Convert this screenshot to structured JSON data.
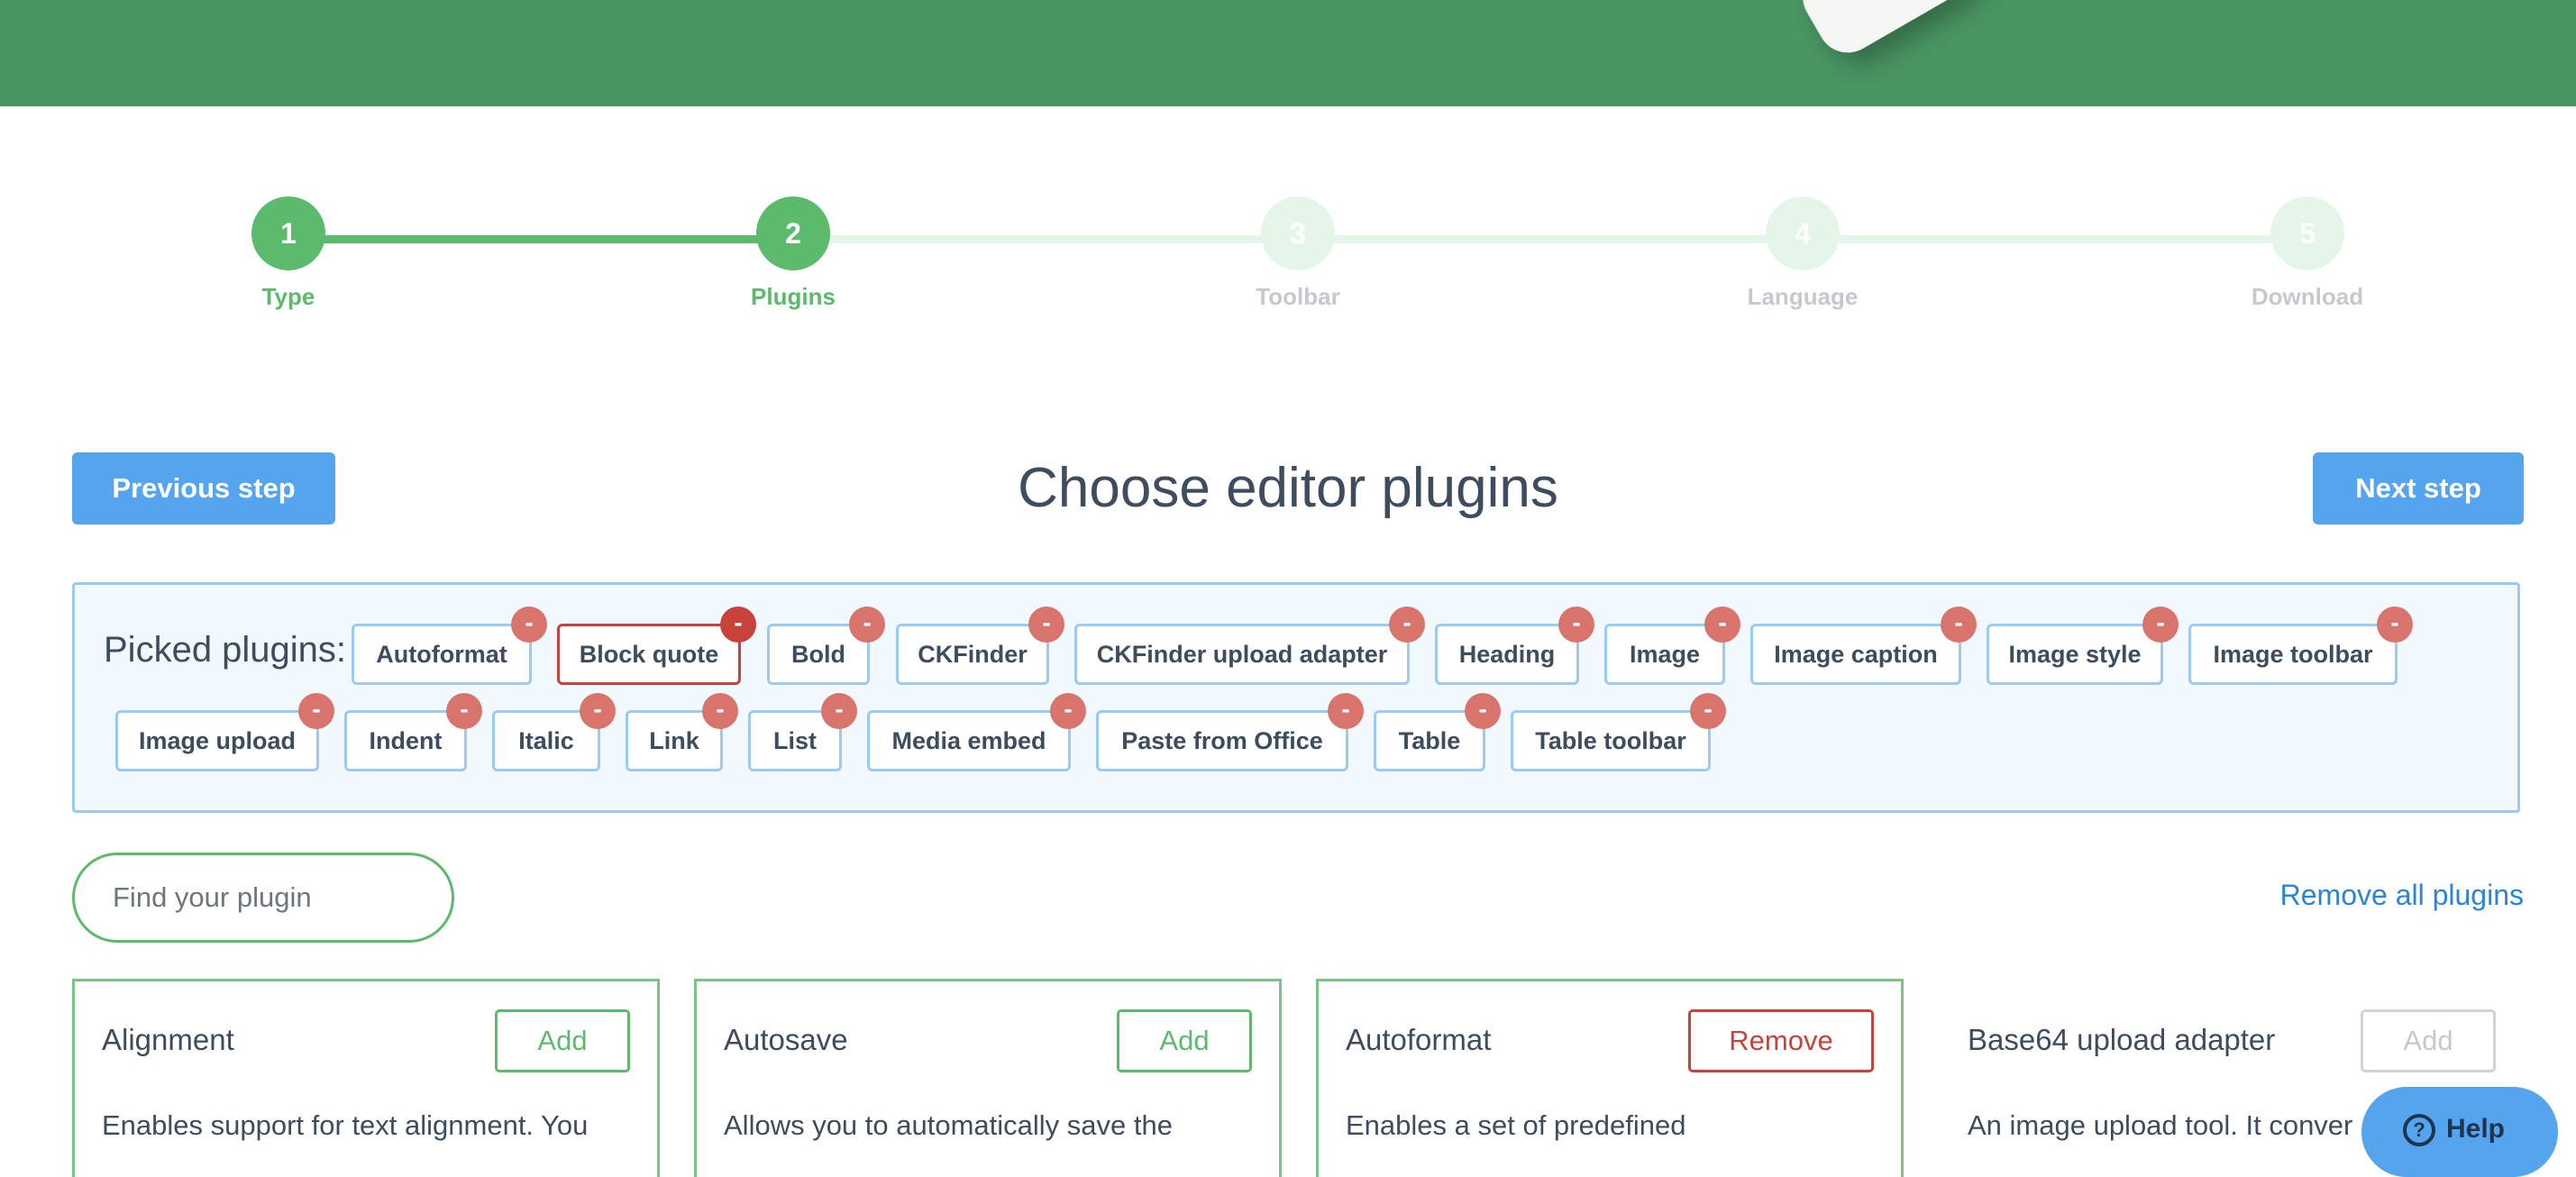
{
  "steps": [
    {
      "number": "1",
      "label": "Type",
      "state": "done"
    },
    {
      "number": "2",
      "label": "Plugins",
      "state": "done"
    },
    {
      "number": "3",
      "label": "Toolbar",
      "state": "todo"
    },
    {
      "number": "4",
      "label": "Language",
      "state": "todo"
    },
    {
      "number": "5",
      "label": "Download",
      "state": "todo"
    }
  ],
  "header": {
    "prev_label": "Previous step",
    "title": "Choose editor plugins",
    "next_label": "Next step"
  },
  "picked": {
    "title": "Picked plugins:",
    "remove_glyph": "-",
    "chips": [
      "Autoformat",
      "Block quote",
      "Bold",
      "CKFinder",
      "CKFinder upload adapter",
      "Heading",
      "Image",
      "Image caption",
      "Image style",
      "Image toolbar",
      "Image upload",
      "Indent",
      "Italic",
      "Link",
      "List",
      "Media embed",
      "Paste from Office",
      "Table",
      "Table toolbar"
    ]
  },
  "search": {
    "placeholder": "Find your plugin",
    "remove_all_label": "Remove all plugins"
  },
  "cards": [
    {
      "name": "Alignment",
      "button": "Add",
      "description": "Enables support for text alignment. You"
    },
    {
      "name": "Autosave",
      "button": "Add",
      "description": "Allows you to automatically save the"
    },
    {
      "name": "Autoformat",
      "button": "Remove",
      "description": "Enables a set of predefined"
    },
    {
      "name": "Base64 upload adapter",
      "button": "Add",
      "description": "An image upload tool. It conver"
    }
  ],
  "help": {
    "label": "Help",
    "icon_glyph": "?"
  },
  "colors": {
    "banner": "#4a9563",
    "accent_green": "#5cba6d",
    "accent_blue": "#55a4ee",
    "danger": "#c8423b"
  }
}
